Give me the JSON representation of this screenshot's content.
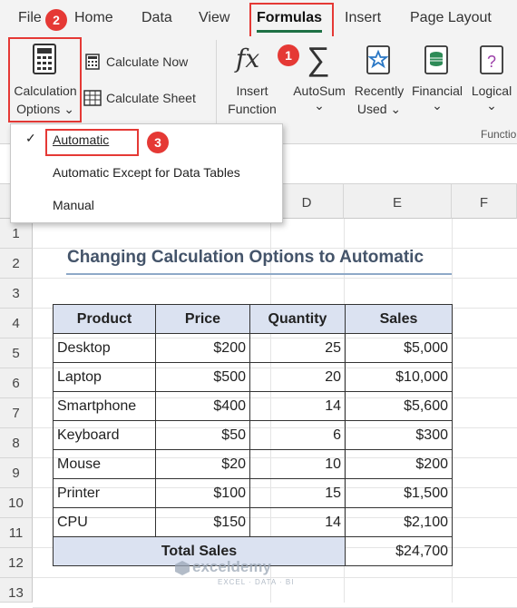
{
  "tabs": {
    "file": "File",
    "home": "Home",
    "data": "Data",
    "view": "View",
    "formulas": "Formulas",
    "insert": "Insert",
    "page_layout": "Page Layout"
  },
  "ribbon": {
    "calc_options_line1": "Calculation",
    "calc_options_line2": "Options",
    "calc_now": "Calculate Now",
    "calc_sheet": "Calculate Sheet",
    "insert_function_line1": "Insert",
    "insert_function_line2": "Function",
    "autosum": "AutoSum",
    "recently_used_line1": "Recently",
    "recently_used_line2": "Used",
    "financial": "Financial",
    "logical": "Logical",
    "function_library_partial": "Functio",
    "fx_glyph": "fx",
    "sigma_glyph": "∑",
    "chevron": "⌄"
  },
  "annotations": {
    "badge1": "1",
    "badge2": "2",
    "badge3": "3",
    "accent_color": "#e53935"
  },
  "calc_menu": {
    "automatic": "Automatic",
    "automatic_except": "Automatic Except for Data Tables",
    "manual": "Manual",
    "checkmark": "✓",
    "selected": "Automatic"
  },
  "sheet": {
    "columns": [
      "D",
      "E",
      "F"
    ],
    "rows": [
      "1",
      "2",
      "3",
      "4",
      "5",
      "6",
      "7",
      "8",
      "9",
      "10",
      "11",
      "12",
      "13"
    ],
    "title": "Changing Calculation Options to Automatic",
    "headers": [
      "Product",
      "Price",
      "Quantity",
      "Sales"
    ],
    "products": [
      {
        "product": "Desktop",
        "price": "$200",
        "quantity": "25",
        "sales": "$5,000"
      },
      {
        "product": "Laptop",
        "price": "$500",
        "quantity": "20",
        "sales": "$10,000"
      },
      {
        "product": "Smartphone",
        "price": "$400",
        "quantity": "14",
        "sales": "$5,600"
      },
      {
        "product": "Keyboard",
        "price": "$50",
        "quantity": "6",
        "sales": "$300"
      },
      {
        "product": "Mouse",
        "price": "$20",
        "quantity": "10",
        "sales": "$200"
      },
      {
        "product": "Printer",
        "price": "$100",
        "quantity": "15",
        "sales": "$1,500"
      },
      {
        "product": "CPU",
        "price": "$150",
        "quantity": "14",
        "sales": "$2,100"
      }
    ],
    "total_label": "Total Sales",
    "total_value": "$24,700"
  },
  "watermark": {
    "name": "exceldemy",
    "tagline": "EXCEL · DATA · BI"
  }
}
